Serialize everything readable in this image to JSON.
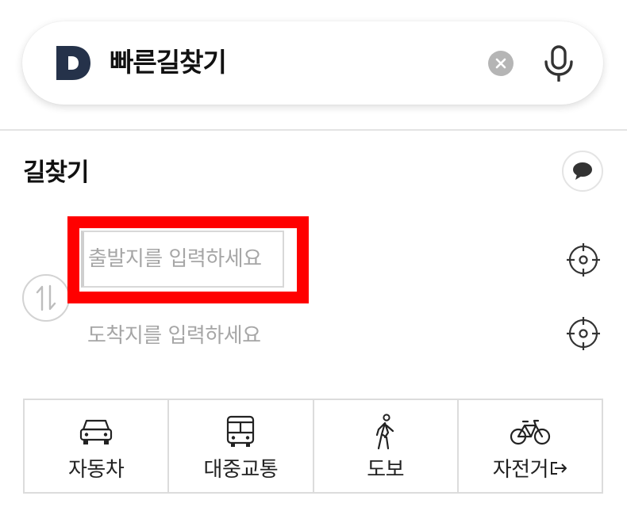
{
  "search": {
    "query": "빠른길찾기",
    "logo_letter": "D"
  },
  "section": {
    "title": "길찾기"
  },
  "route": {
    "origin_placeholder": "출발지를 입력하세요",
    "destination_placeholder": "도착지를 입력하세요"
  },
  "tabs": [
    {
      "label": "자동차",
      "icon": "car-icon"
    },
    {
      "label": "대중교통",
      "icon": "bus-icon"
    },
    {
      "label": "도보",
      "icon": "walking-icon"
    },
    {
      "label": "자전거",
      "icon": "bicycle-icon",
      "external": true
    }
  ],
  "colors": {
    "logo": "#25324a",
    "highlight": "#ff0000",
    "placeholder": "#a6a6a6",
    "border": "#dcdcdc"
  }
}
